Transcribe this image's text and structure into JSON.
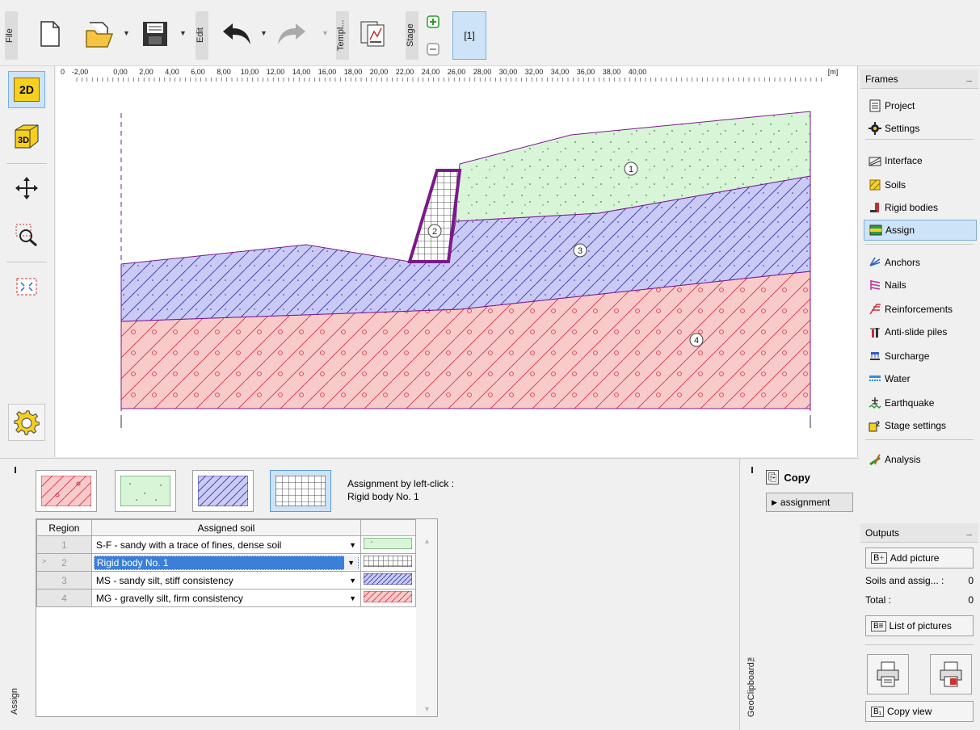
{
  "toolbar": {
    "file_label": "File",
    "edit_label": "Edit",
    "templ_label": "Templ...",
    "stage_label": "Stage",
    "stage_tab": "[1]"
  },
  "left_tools": {
    "view2d": "2D",
    "view3d": "3D"
  },
  "ruler": {
    "ticks": [
      "0",
      "-2,00",
      "0,00",
      "2,00",
      "4,00",
      "6,00",
      "8,00",
      "10,00",
      "12,00",
      "14,00",
      "16,00",
      "18,00",
      "20,00",
      "22,00",
      "24,00",
      "26,00",
      "28,00",
      "30,00",
      "32,00",
      "34,00",
      "36,00",
      "38,00",
      "40,00",
      "[m]"
    ]
  },
  "regions": {
    "labels": [
      "1",
      "2",
      "3",
      "4"
    ],
    "colors": {
      "soil1": "#d6f5d6",
      "soil3": "#c8c8f5",
      "soil4": "#f8c8c8",
      "outline": "#7a1a8a"
    }
  },
  "frames": {
    "title": "Frames",
    "items": [
      {
        "label": "Project",
        "icon": "document-icon"
      },
      {
        "label": "Settings",
        "icon": "gear-icon"
      },
      {
        "label": "Interface",
        "icon": "interface-icon"
      },
      {
        "label": "Soils",
        "icon": "soils-icon"
      },
      {
        "label": "Rigid bodies",
        "icon": "rigid-bodies-icon"
      },
      {
        "label": "Assign",
        "icon": "assign-icon"
      },
      {
        "label": "Anchors",
        "icon": "anchors-icon"
      },
      {
        "label": "Nails",
        "icon": "nails-icon"
      },
      {
        "label": "Reinforcements",
        "icon": "reinforcements-icon"
      },
      {
        "label": "Anti-slide piles",
        "icon": "piles-icon"
      },
      {
        "label": "Surcharge",
        "icon": "surcharge-icon"
      },
      {
        "label": "Water",
        "icon": "water-icon"
      },
      {
        "label": "Earthquake",
        "icon": "earthquake-icon"
      },
      {
        "label": "Stage settings",
        "icon": "stage-settings-icon"
      },
      {
        "label": "Analysis",
        "icon": "analysis-icon"
      }
    ],
    "selected": "Assign"
  },
  "outputs": {
    "title": "Outputs",
    "add_picture": "Add picture",
    "soils_label": "Soils and assig... :",
    "soils_count": "0",
    "total_label": "Total :",
    "total_count": "0",
    "list_pictures": "List of pictures",
    "copy_view": "Copy view"
  },
  "assign_panel": {
    "side_label": "Assign",
    "assignment_title": "Assignment by left-click :",
    "assignment_value": "Rigid body No. 1",
    "columns": [
      "Region",
      "Assigned soil"
    ],
    "rows": [
      {
        "region": "1",
        "soil": "S-F - sandy with a trace of fines, dense soil"
      },
      {
        "region": "2",
        "soil": "Rigid body No. 1"
      },
      {
        "region": "3",
        "soil": "MS - sandy silt, stiff consistency"
      },
      {
        "region": "4",
        "soil": "MG - gravelly silt, firm consistency"
      }
    ]
  },
  "clipboard": {
    "side_label": "GeoClipboard™",
    "copy_label": "Copy",
    "assignment_btn": "assignment"
  }
}
